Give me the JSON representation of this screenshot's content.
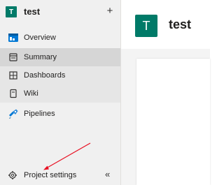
{
  "sidebar": {
    "project": {
      "avatar_letter": "T",
      "name": "test",
      "add_symbol": "+"
    },
    "items": [
      {
        "label": "Overview",
        "icon": "overview-icon"
      },
      {
        "label": "Summary",
        "icon": "summary-icon",
        "active": true
      },
      {
        "label": "Dashboards",
        "icon": "dashboards-icon"
      },
      {
        "label": "Wiki",
        "icon": "wiki-icon"
      },
      {
        "label": "Pipelines",
        "icon": "pipelines-icon"
      }
    ],
    "footer": {
      "label": "Project settings",
      "icon": "gear-icon",
      "collapse_symbol": "«"
    }
  },
  "main": {
    "avatar_letter": "T",
    "title": "test"
  },
  "colors": {
    "accent": "#007a68",
    "annotation_arrow": "#e81123"
  }
}
